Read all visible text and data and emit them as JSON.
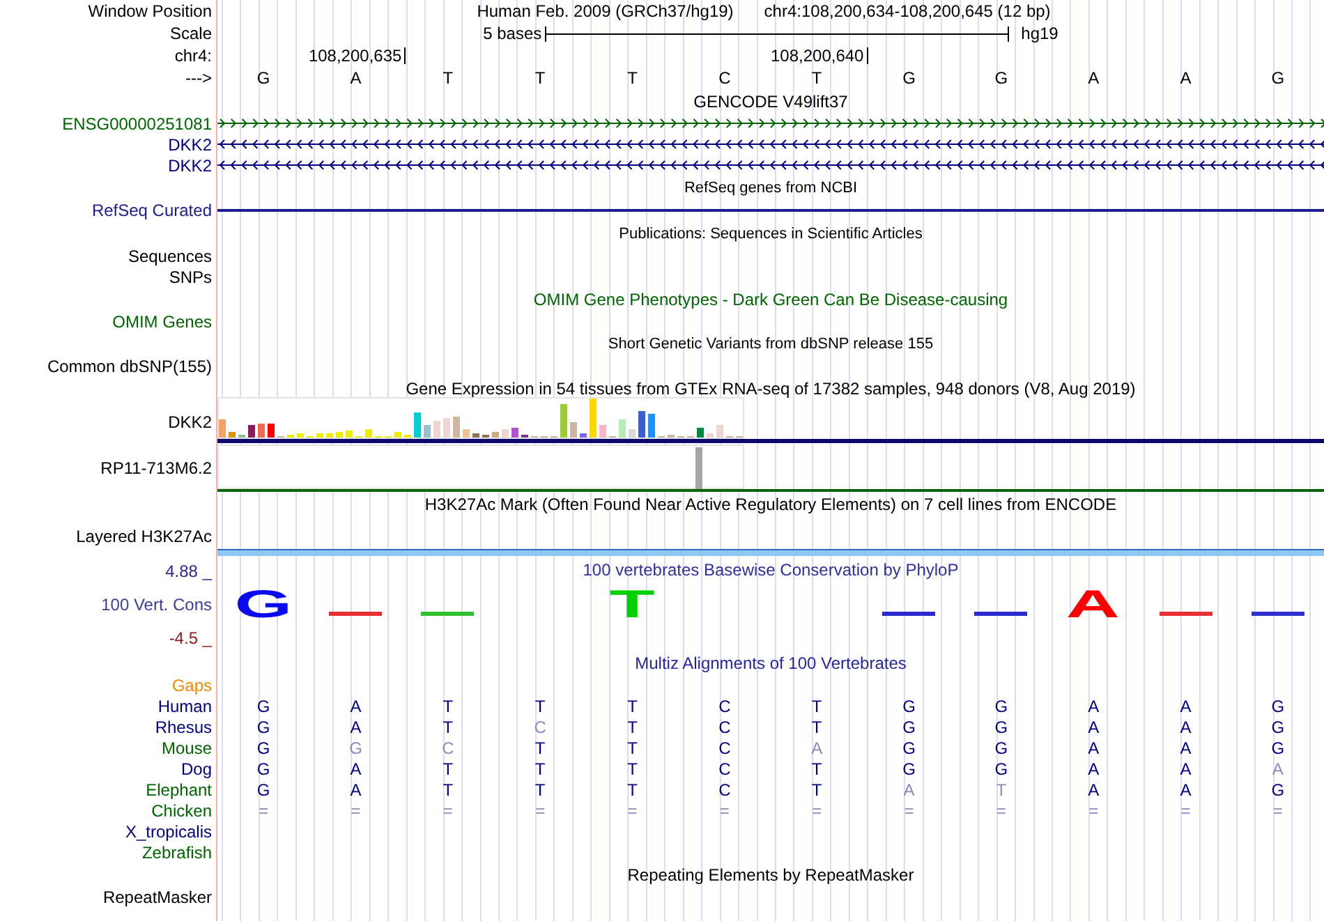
{
  "tracks": [
    {
      "kind": "position",
      "label": "Window Position",
      "color": "#000000",
      "assembly": "Human Feb. 2009 (GRCh37/hg19)",
      "range": "chr4:108,200,634-108,200,645 (12 bp)"
    },
    {
      "kind": "scale",
      "label": "Scale",
      "color": "#000000",
      "span": "5 bases",
      "genome": "hg19"
    },
    {
      "kind": "coords",
      "label": "chr4:",
      "color": "#000000",
      "positions": [
        {
          "kind": "blank"
        },
        {
          "kind": "tick",
          "text": "108,200,635"
        },
        {
          "kind": "blank"
        },
        {
          "kind": "blank"
        },
        {
          "kind": "blank"
        },
        {
          "kind": "blank"
        },
        {
          "kind": "tick",
          "text": "108,200,640"
        },
        {
          "kind": "blank"
        },
        {
          "kind": "blank"
        },
        {
          "kind": "blank"
        },
        {
          "kind": "blank"
        },
        {
          "kind": "blank"
        }
      ]
    },
    {
      "kind": "bases",
      "label": "--->",
      "color": "#000000",
      "bases": [
        "G",
        "A",
        "T",
        "T",
        "T",
        "C",
        "T",
        "G",
        "G",
        "A",
        "A",
        "G"
      ]
    },
    {
      "kind": "title",
      "text": "GENCODE V49lift37",
      "color": "#000000"
    },
    {
      "kind": "gene_forward",
      "label": "ENSG00000251081",
      "color": "#006400"
    },
    {
      "kind": "gene_reverse",
      "label": "DKK2",
      "color": "#000080"
    },
    {
      "kind": "gene_reverse",
      "label": "DKK2",
      "color": "#000080"
    },
    {
      "kind": "subtitle",
      "text": "RefSeq genes from NCBI",
      "color": "#000000"
    },
    {
      "kind": "line",
      "label": "RefSeq Curated",
      "color": "#1c1c8c"
    },
    {
      "kind": "subtitle",
      "text": "Publications: Sequences in Scientific Articles",
      "color": "#000000"
    },
    {
      "kind": "label",
      "label": "Sequences",
      "color": "#000000"
    },
    {
      "kind": "label",
      "label": "SNPs",
      "color": "#000000"
    },
    {
      "kind": "title",
      "text": "OMIM Gene Phenotypes - Dark Green Can Be Disease-causing",
      "color": "#006400"
    },
    {
      "kind": "label",
      "label": "OMIM Genes",
      "color": "#006400"
    },
    {
      "kind": "subtitle",
      "text": "Short Genetic Variants from dbSNP release 155",
      "color": "#000000"
    },
    {
      "kind": "label",
      "label": "Common dbSNP(155)",
      "color": "#000000"
    },
    {
      "kind": "title",
      "text": "Gene Expression in 54 tissues from GTEx RNA-seq of 17382 samples, 948 donors (V8, Aug 2019)",
      "color": "#000000"
    },
    {
      "kind": "expression",
      "label": "DKK2",
      "color": "#000000"
    },
    {
      "kind": "expression_single",
      "label": "RP11-713M6.2",
      "color": "#000000"
    },
    {
      "kind": "title",
      "text": "H3K27Ac Mark (Often Found Near Active Regulatory Elements) on 7 cell lines from ENCODE",
      "color": "#000000"
    },
    {
      "kind": "layered",
      "label": "Layered H3K27Ac",
      "color": "#000000"
    },
    {
      "kind": "conservation",
      "label": "100 Vert. Cons",
      "color": "#3c3c9c",
      "max": "4.88 _",
      "min": "-4.5 _",
      "title": "100 vertebrates Basewise Conservation by PhyloP",
      "logo": [
        {
          "kind": "tall",
          "letter": "G",
          "color": "#0a0af0"
        },
        {
          "kind": "flat",
          "color": "#e83030"
        },
        {
          "kind": "flat",
          "color": "#30c030"
        },
        {
          "kind": "none"
        },
        {
          "kind": "tall",
          "letter": "T",
          "color": "#00d000"
        },
        {
          "kind": "none"
        },
        {
          "kind": "none"
        },
        {
          "kind": "flat",
          "color": "#2a2ad0"
        },
        {
          "kind": "flat",
          "color": "#2a2ad0"
        },
        {
          "kind": "tall",
          "letter": "A",
          "color": "#ff0000"
        },
        {
          "kind": "flat",
          "color": "#e83030"
        },
        {
          "kind": "flat",
          "color": "#3030d0"
        }
      ]
    },
    {
      "kind": "title",
      "text": "Multiz Alignments of 100 Vertebrates",
      "color": "#26269a"
    },
    {
      "kind": "label",
      "label": "Gaps",
      "color": "#f08c00"
    },
    {
      "kind": "alignment",
      "label": "Human",
      "color": "#000080",
      "bases": [
        {
          "base": "G",
          "faded": false
        },
        {
          "base": "A",
          "faded": false
        },
        {
          "base": "T",
          "faded": false
        },
        {
          "base": "T",
          "faded": false
        },
        {
          "base": "T",
          "faded": false
        },
        {
          "base": "C",
          "faded": false
        },
        {
          "base": "T",
          "faded": false
        },
        {
          "base": "G",
          "faded": false
        },
        {
          "base": "G",
          "faded": false
        },
        {
          "base": "A",
          "faded": false
        },
        {
          "base": "A",
          "faded": false
        },
        {
          "base": "G",
          "faded": false
        }
      ]
    },
    {
      "kind": "alignment",
      "label": "Rhesus",
      "color": "#000080",
      "bases": [
        {
          "base": "G",
          "faded": false
        },
        {
          "base": "A",
          "faded": false
        },
        {
          "base": "T",
          "faded": false
        },
        {
          "base": "C",
          "faded": true
        },
        {
          "base": "T",
          "faded": false
        },
        {
          "base": "C",
          "faded": false
        },
        {
          "base": "T",
          "faded": false
        },
        {
          "base": "G",
          "faded": false
        },
        {
          "base": "G",
          "faded": false
        },
        {
          "base": "A",
          "faded": false
        },
        {
          "base": "A",
          "faded": false
        },
        {
          "base": "G",
          "faded": false
        }
      ]
    },
    {
      "kind": "alignment",
      "label": "Mouse",
      "color": "#006400",
      "bases": [
        {
          "base": "G",
          "faded": false
        },
        {
          "base": "G",
          "faded": true
        },
        {
          "base": "C",
          "faded": true
        },
        {
          "base": "T",
          "faded": false
        },
        {
          "base": "T",
          "faded": false
        },
        {
          "base": "C",
          "faded": false
        },
        {
          "base": "A",
          "faded": true
        },
        {
          "base": "G",
          "faded": false
        },
        {
          "base": "G",
          "faded": false
        },
        {
          "base": "A",
          "faded": false
        },
        {
          "base": "A",
          "faded": false
        },
        {
          "base": "G",
          "faded": false
        }
      ]
    },
    {
      "kind": "alignment",
      "label": "Dog",
      "color": "#000080",
      "bases": [
        {
          "base": "G",
          "faded": false
        },
        {
          "base": "A",
          "faded": false
        },
        {
          "base": "T",
          "faded": false
        },
        {
          "base": "T",
          "faded": false
        },
        {
          "base": "T",
          "faded": false
        },
        {
          "base": "C",
          "faded": false
        },
        {
          "base": "T",
          "faded": false
        },
        {
          "base": "G",
          "faded": false
        },
        {
          "base": "G",
          "faded": false
        },
        {
          "base": "A",
          "faded": false
        },
        {
          "base": "A",
          "faded": false
        },
        {
          "base": "A",
          "faded": true
        }
      ]
    },
    {
      "kind": "alignment",
      "label": "Elephant",
      "color": "#006400",
      "bases": [
        {
          "base": "G",
          "faded": false
        },
        {
          "base": "A",
          "faded": false
        },
        {
          "base": "T",
          "faded": false
        },
        {
          "base": "T",
          "faded": false
        },
        {
          "base": "T",
          "faded": false
        },
        {
          "base": "C",
          "faded": false
        },
        {
          "base": "T",
          "faded": false
        },
        {
          "base": "A",
          "faded": true
        },
        {
          "base": "T",
          "faded": true
        },
        {
          "base": "A",
          "faded": false
        },
        {
          "base": "A",
          "faded": false
        },
        {
          "base": "G",
          "faded": false
        }
      ]
    },
    {
      "kind": "alignment",
      "label": "Chicken",
      "color": "#006400",
      "bases": [
        {
          "base": "=",
          "faded": true
        },
        {
          "base": "=",
          "faded": true
        },
        {
          "base": "=",
          "faded": true
        },
        {
          "base": "=",
          "faded": true
        },
        {
          "base": "=",
          "faded": true
        },
        {
          "base": "=",
          "faded": true
        },
        {
          "base": "=",
          "faded": true
        },
        {
          "base": "=",
          "faded": true
        },
        {
          "base": "=",
          "faded": true
        },
        {
          "base": "=",
          "faded": true
        },
        {
          "base": "=",
          "faded": true
        },
        {
          "base": "=",
          "faded": true
        }
      ]
    },
    {
      "kind": "label",
      "label": "X_tropicalis",
      "color": "#000080"
    },
    {
      "kind": "label",
      "label": "Zebrafish",
      "color": "#006400"
    },
    {
      "kind": "title",
      "text": "Repeating Elements by RepeatMasker",
      "color": "#000000"
    },
    {
      "kind": "label",
      "label": "RepeatMasker",
      "color": "#000000"
    }
  ]
}
